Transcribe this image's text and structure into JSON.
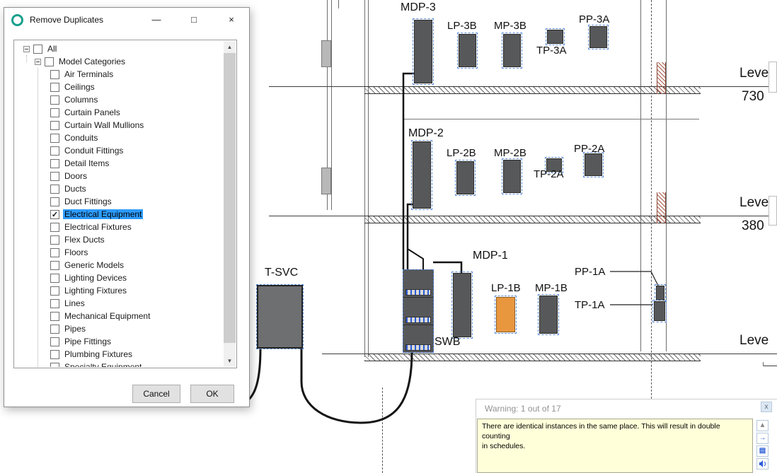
{
  "dialog": {
    "title": "Remove Duplicates",
    "controls": {
      "minimize": "—",
      "maximize": "□",
      "close": "×"
    },
    "tree": {
      "root_label": "All",
      "group_label": "Model Categories",
      "categories": [
        "Air Terminals",
        "Ceilings",
        "Columns",
        "Curtain Panels",
        "Curtain Wall Mullions",
        "Conduits",
        "Conduit Fittings",
        "Detail Items",
        "Doors",
        "Ducts",
        "Duct Fittings",
        "Electrical Equipment",
        "Electrical Fixtures",
        "Flex Ducts",
        "Floors",
        "Generic Models",
        "Lighting Devices",
        "Lighting Fixtures",
        "Lines",
        "Mechanical Equipment",
        "Pipes",
        "Pipe Fittings",
        "Plumbing Fixtures",
        "Specialty Equipment"
      ],
      "checked_index": 11
    },
    "buttons": {
      "cancel": "Cancel",
      "ok": "OK"
    }
  },
  "drawing": {
    "labels": {
      "mdp3": "MDP-3",
      "lp3b": "LP-3B",
      "mp3b": "MP-3B",
      "pp3a": "PP-3A",
      "tp3a": "TP-3A",
      "mdp2": "MDP-2",
      "lp2b": "LP-2B",
      "mp2b": "MP-2B",
      "pp2a": "PP-2A",
      "tp2a": "TP-2A",
      "mdp1": "MDP-1",
      "lp1b": "LP-1B",
      "mp1b": "MP-1B",
      "pp1a": "PP-1A",
      "tp1a": "TP-1A",
      "tsvc": "T-SVC",
      "swb": "SWB"
    },
    "levels": [
      {
        "name": "Leve",
        "elevation": "730"
      },
      {
        "name": "Leve",
        "elevation": "380"
      },
      {
        "name": "Leve",
        "elevation": ""
      }
    ],
    "colors": {
      "equipment_gray": "#57585a",
      "selected_panel_orange": "#e8973f",
      "selection_dash_blue": "#5b8dd9"
    }
  },
  "warning_panel": {
    "title": "Warning: 1 out of 17",
    "close_glyph": "x",
    "message_lines": [
      "There are identical instances in the same place. This will result in double counting",
      "in schedules."
    ],
    "icons": [
      {
        "name": "scroll-up-icon",
        "glyph": "▲"
      },
      {
        "name": "next-warning-icon",
        "glyph": "→"
      },
      {
        "name": "expand-warnings-icon",
        "glyph": "▤"
      },
      {
        "name": "audio-icon",
        "glyph": ""
      }
    ]
  }
}
